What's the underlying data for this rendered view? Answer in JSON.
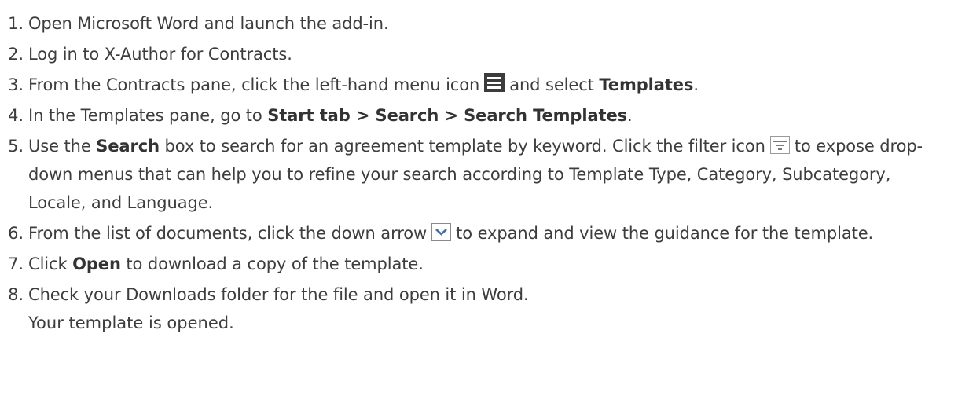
{
  "steps": [
    {
      "number": "1",
      "parts": [
        "Open Microsoft Word and launch the add-in."
      ]
    },
    {
      "number": "2",
      "parts": [
        "Log in to X-Author for Contracts."
      ]
    },
    {
      "number": "3",
      "parts": [
        "From the Contracts pane, click the left-hand menu icon",
        "and select",
        "Templates",
        "."
      ]
    },
    {
      "number": "4",
      "parts": [
        "In the Templates pane, go to",
        "Start tab > Search > Search Templates",
        "."
      ]
    },
    {
      "number": "5",
      "parts": [
        "Use the",
        "Search",
        "box to search for an agreement template by keyword. Click the filter icon",
        "to expose drop-down menus that can help you to refine your search according to Template Type, Category, Subcategory, Locale, and Language."
      ]
    },
    {
      "number": "6",
      "parts": [
        "From the list of documents, click the down arrow",
        "to expand and view the guidance for the template."
      ]
    },
    {
      "number": "7",
      "parts": [
        "Click",
        "Open",
        "to download a copy of the template."
      ]
    },
    {
      "number": "8",
      "parts": [
        "Check your Downloads folder for the file and open it in Word."
      ]
    }
  ],
  "result": "Your template is opened.",
  "icons": {
    "menu": "hamburger-menu-icon",
    "filter": "filter-icon",
    "down_arrow": "chevron-down-icon"
  },
  "colors": {
    "text": "#3d3d3d",
    "menu_icon_bg": "#3c3c3c"
  }
}
